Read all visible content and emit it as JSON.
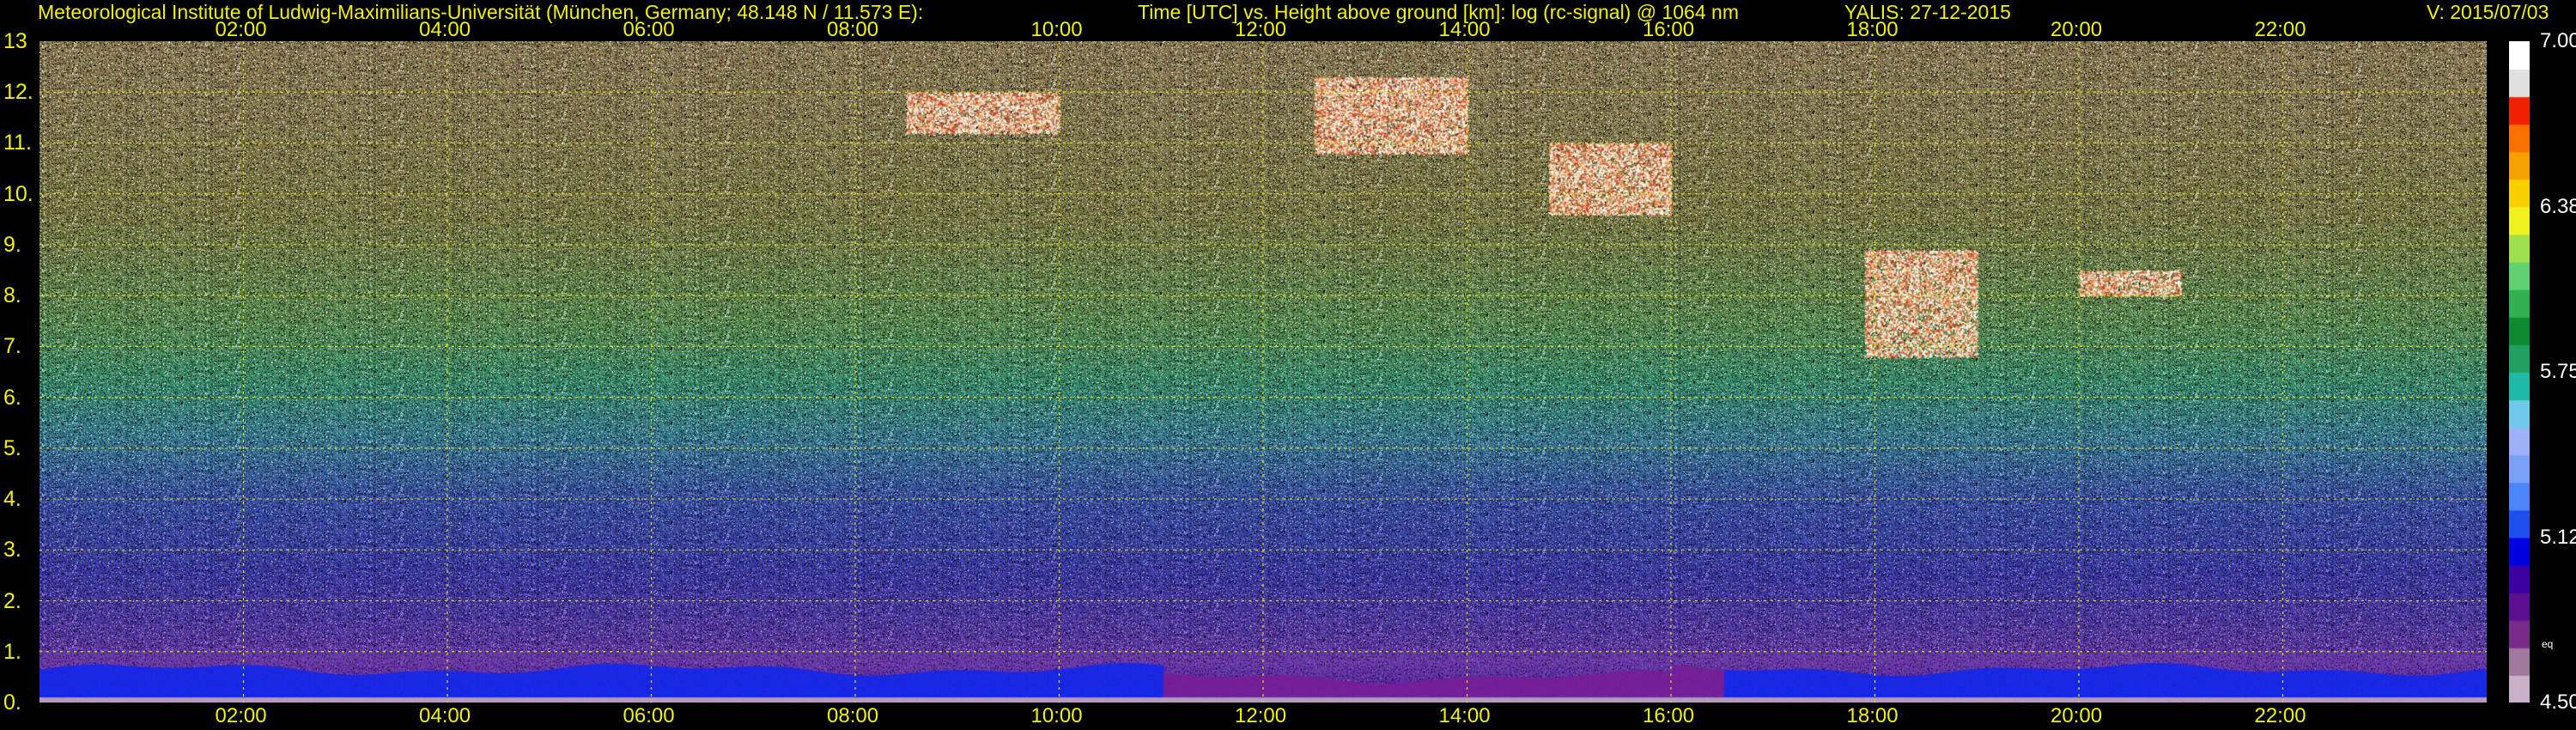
{
  "header": {
    "institute": "Meteorological Institute of Ludwig-Maximilians-Universität (München, Germany; 48.148 N / 11.573 E):",
    "description": "Time [UTC] vs. Height above ground [km]: log (rc-signal) @ 1064 nm",
    "station": "YALIS: 27-12-2015",
    "version": "V: 2015/07/03"
  },
  "chart_data": {
    "type": "heatmap",
    "title": "Time [UTC] vs. Height above ground [km]: log (rc-signal) @ 1064 nm",
    "xlabel": "Time [UTC]",
    "ylabel": "Height above ground [km]",
    "x_unit": "hours UTC",
    "xlim": [
      0,
      24
    ],
    "ylim": [
      0,
      13
    ],
    "x_ticks": [
      "02:00",
      "04:00",
      "06:00",
      "08:00",
      "10:00",
      "12:00",
      "14:00",
      "16:00",
      "18:00",
      "20:00",
      "22:00"
    ],
    "y_ticks": [
      "0.",
      "1.",
      "2.",
      "3.",
      "4.",
      "5.",
      "6.",
      "7.",
      "8.",
      "9.",
      "10.",
      "11.",
      "12.",
      "13"
    ],
    "grid": true,
    "colorbar": {
      "label": "log (rc-signal)",
      "range": [
        4.5,
        7.0
      ],
      "tick_labels": [
        "7.00",
        "6.38",
        "5.75",
        "5.12",
        "4.50"
      ],
      "small_label": "eq",
      "colors": [
        "#c8b0c8",
        "#a078a0",
        "#7a2a8a",
        "#5a1090",
        "#3a00a0",
        "#0000e0",
        "#1e50f0",
        "#4a86f8",
        "#7aa0f8",
        "#a0b0f8",
        "#70c8e8",
        "#20b8a8",
        "#20a060",
        "#108a30",
        "#30b050",
        "#60d070",
        "#a0e050",
        "#f0f020",
        "#f8d000",
        "#f8a000",
        "#f87000",
        "#f02000",
        "#e0e0e0",
        "#ffffff"
      ]
    },
    "features": [
      {
        "name": "boundary layer aerosol",
        "x_range_hours": [
          0,
          24
        ],
        "height_km": [
          0.1,
          0.8
        ]
      },
      {
        "name": "cirrus cloud",
        "x_range_hours": [
          8.5,
          10.0
        ],
        "height_km": [
          11.2,
          12.0
        ]
      },
      {
        "name": "cirrus cloud",
        "x_range_hours": [
          12.5,
          14.0
        ],
        "height_km": [
          10.8,
          12.3
        ]
      },
      {
        "name": "cirrus cloud",
        "x_range_hours": [
          14.8,
          16.0
        ],
        "height_km": [
          9.6,
          11.0
        ]
      },
      {
        "name": "cloud",
        "x_range_hours": [
          17.9,
          19.0
        ],
        "height_km": [
          6.8,
          8.9
        ]
      },
      {
        "name": "cloud",
        "x_range_hours": [
          20.0,
          21.0
        ],
        "height_km": [
          8.0,
          8.5
        ]
      }
    ]
  }
}
